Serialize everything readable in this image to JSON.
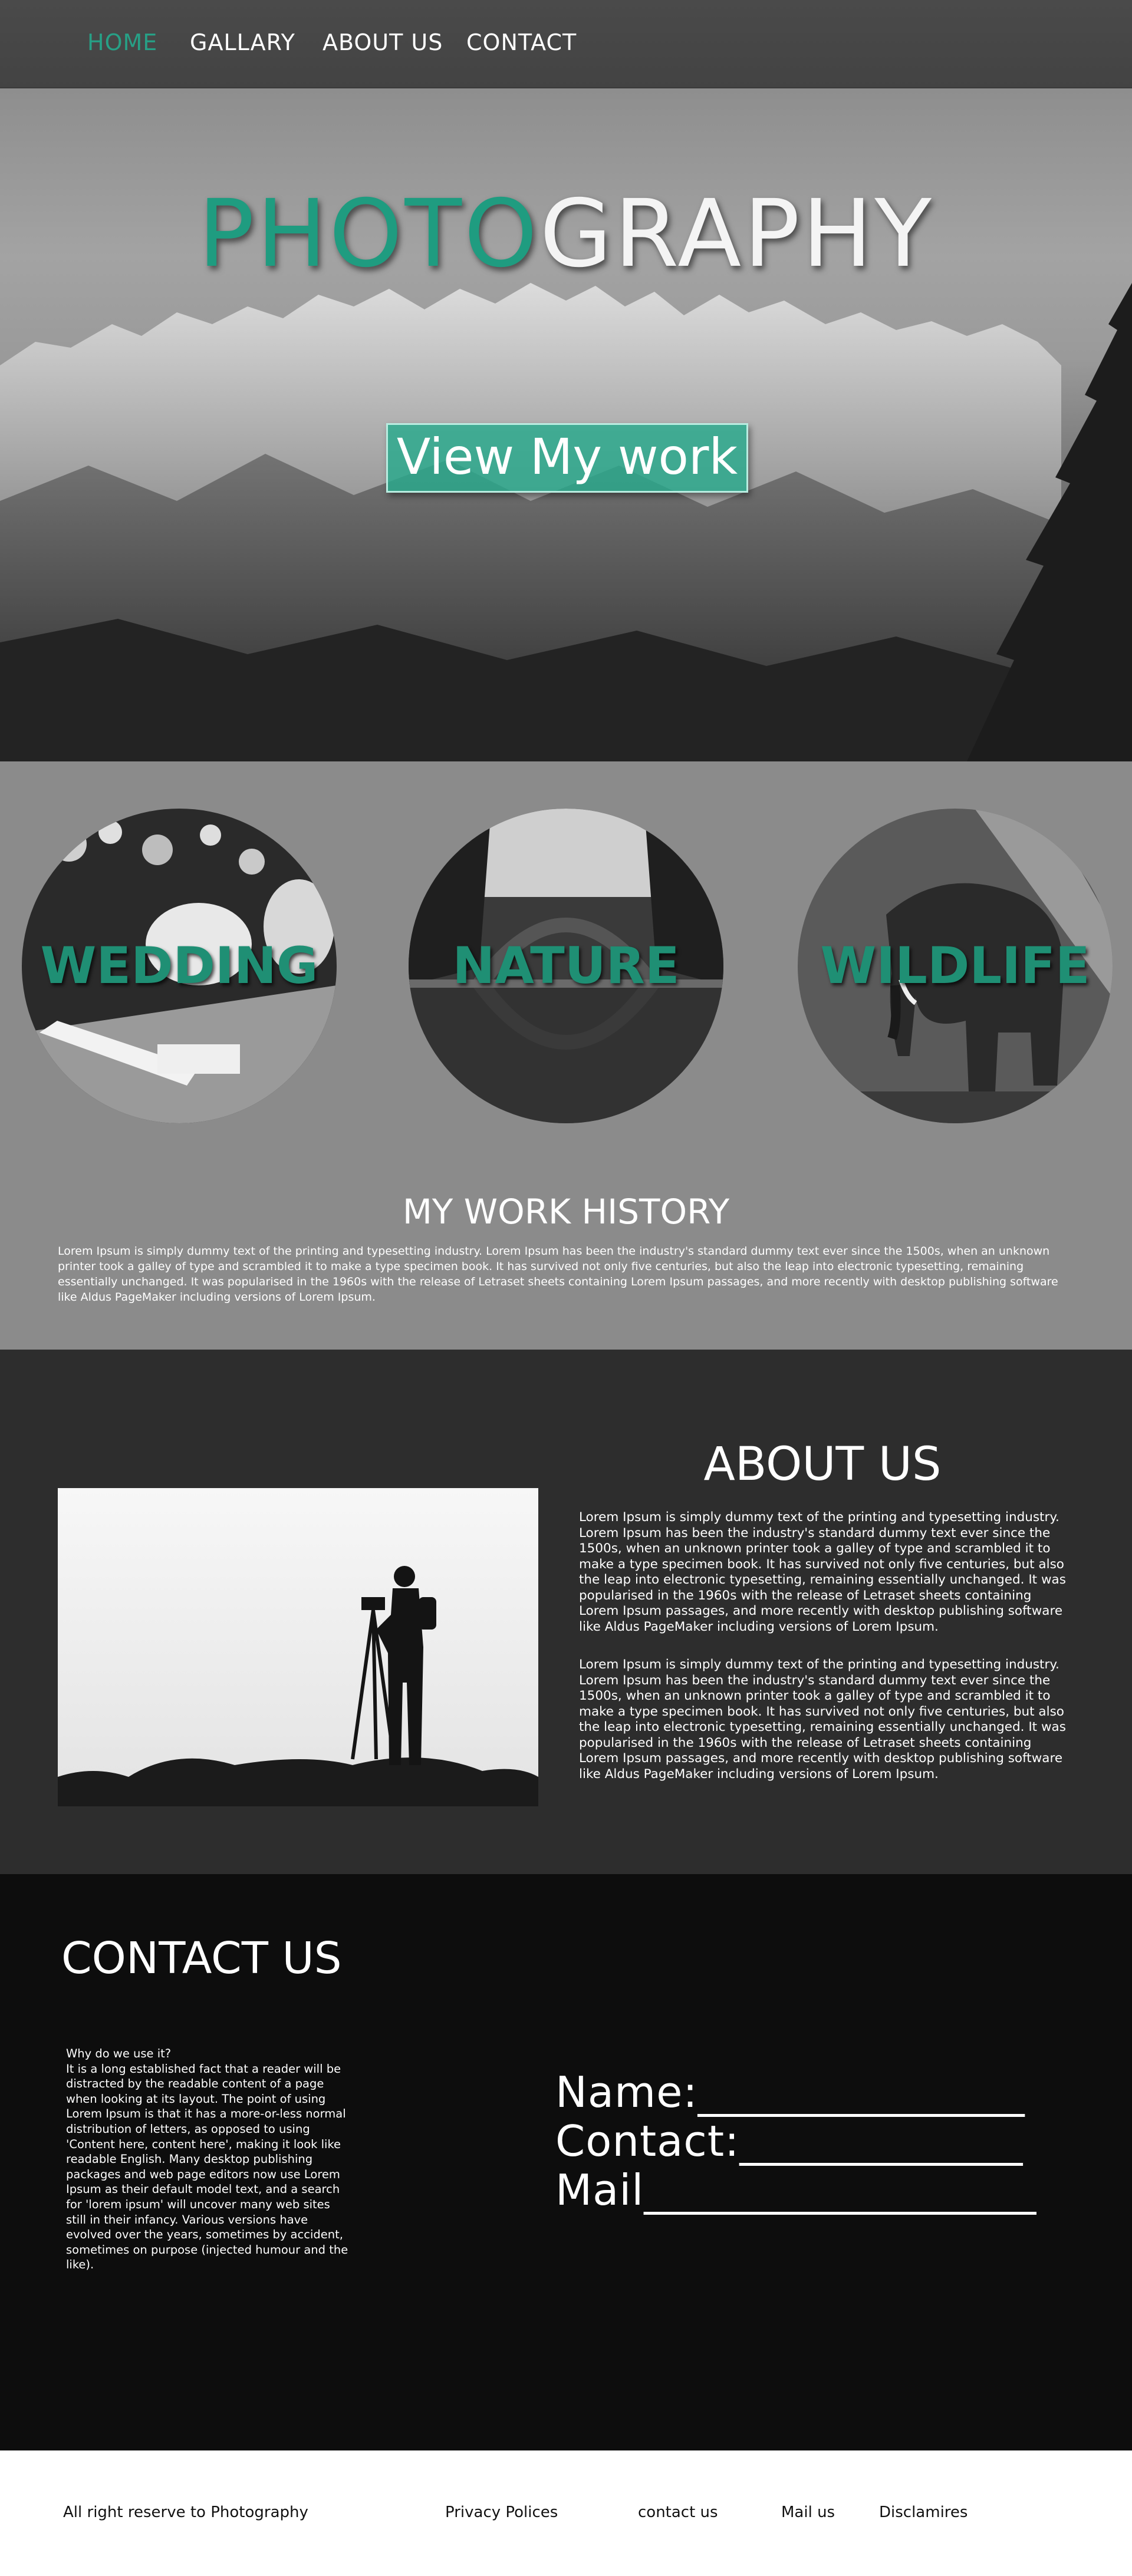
{
  "nav": {
    "items": [
      {
        "label": "HOME",
        "active": true
      },
      {
        "label": "GALLARY",
        "active": false
      },
      {
        "label": "ABOUT US",
        "active": false
      },
      {
        "label": "CONTACT",
        "active": false
      }
    ]
  },
  "hero": {
    "title_green": "PHOTO",
    "title_white": "GRAPHY",
    "button_label": "View My work"
  },
  "categories": [
    {
      "label": "WEDDING"
    },
    {
      "label": "NATURE"
    },
    {
      "label": "WILDLIFE"
    }
  ],
  "history": {
    "title": "MY WORK HISTORY",
    "body": "Lorem Ipsum is simply dummy text of the printing and typesetting industry. Lorem Ipsum has been the industry's standard dummy text ever since the 1500s, when an unknown printer took a galley of type and scrambled it to make a type specimen book. It has survived not only five centuries, but also the leap into electronic typesetting, remaining essentially unchanged. It was popularised in the 1960s with the release of Letraset sheets containing Lorem Ipsum passages, and more recently with desktop publishing software like Aldus PageMaker including versions of Lorem Ipsum."
  },
  "about": {
    "title": "ABOUT US",
    "paragraph_1": "Lorem Ipsum is simply dummy text of the printing and typesetting industry. Lorem Ipsum has been the industry's standard dummy text ever since the 1500s, when an unknown printer took a galley of type and scrambled it to make a type specimen book. It has survived not only five centuries, but also the leap into electronic typesetting, remaining essentially unchanged. It was popularised in the 1960s with the release of Letraset sheets containing Lorem Ipsum passages, and more recently with desktop publishing software like Aldus PageMaker including versions of Lorem Ipsum.",
    "paragraph_2": "Lorem Ipsum is simply dummy text of the printing and typesetting industry. Lorem Ipsum has been the industry's standard dummy text ever since the 1500s, when an unknown printer took a galley of type and scrambled it to make a type specimen book. It has survived not only five centuries, but also the leap into electronic typesetting, remaining essentially unchanged. It was popularised in the 1960s with the release of Letraset sheets containing Lorem Ipsum passages, and more recently with desktop publishing software like Aldus PageMaker including versions of Lorem Ipsum."
  },
  "contact": {
    "title": "CONTACT US",
    "heading": "Why do we use it?",
    "text": "It is a long established fact that a reader will be distracted by the readable content of a page when looking at its layout. The point of using Lorem Ipsum is that it has a more-or-less normal distribution of letters, as opposed to using 'Content here, content here', making it look like readable English. Many desktop publishing packages and web page editors now use Lorem Ipsum as their default model text, and a search for 'lorem ipsum' will uncover many web sites still in their infancy. Various versions have evolved over the years, sometimes by accident, sometimes on purpose (injected humour and the like).",
    "fields": {
      "name": "Name:_______________",
      "contact": "Contact:_____________",
      "mail": "Mail__________________"
    }
  },
  "footer": {
    "copyright": "All right reserve to Photography",
    "links": [
      "Privacy Polices",
      "contact us",
      "Mail us",
      "Disclamires"
    ]
  },
  "colors": {
    "accent": "#1f9c80",
    "nav_bg": "#474747",
    "categories_bg": "#8b8b8b",
    "about_bg": "#2d2d2d",
    "contact_bg": "#0d0d0d",
    "footer_bg": "#ffffff"
  }
}
